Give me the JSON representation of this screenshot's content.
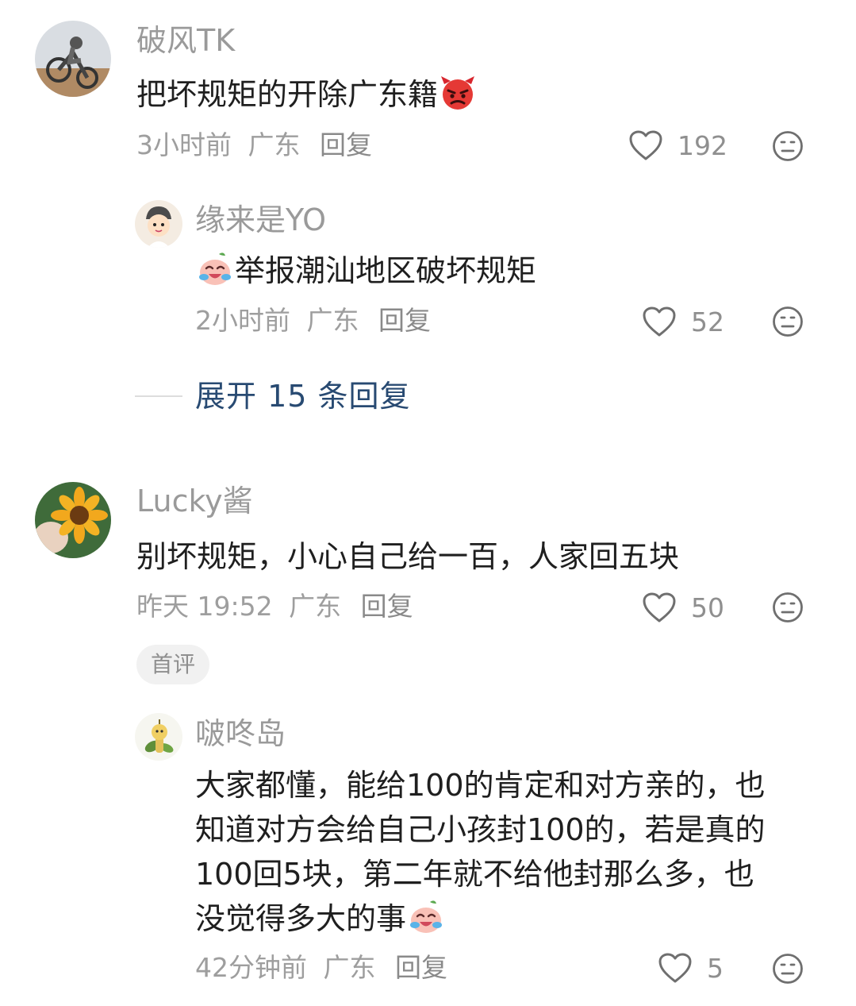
{
  "comments": [
    {
      "username": "破风TK",
      "text": "把坏规矩的开除广东籍",
      "emoji": "angry-devil-emoji",
      "time": "3小时前",
      "location": "广东",
      "reply_label": "回复",
      "likes": "192"
    },
    {
      "username": "Lucky酱",
      "text": "别坏规矩，小心自己给一百，人家回五块",
      "time": "昨天 19:52",
      "location": "广东",
      "reply_label": "回复",
      "likes": "50",
      "badge": "首评"
    }
  ],
  "replies": [
    {
      "username": "缘来是YO",
      "emoji": "crying-laughing-emoji",
      "text": "举报潮汕地区破坏规矩",
      "time": "2小时前",
      "location": "广东",
      "reply_label": "回复",
      "likes": "52"
    },
    {
      "username": "啵咚岛",
      "text_lines": [
        "大家都懂，能给100的肯定和对方亲的，也",
        "知道对方会给自己小孩封100的，若是真的",
        "100回5块，第二年就不给他封那么多，也",
        "没觉得多大的事"
      ],
      "emoji": "crying-laughing-emoji",
      "time": "42分钟前",
      "location": "广东",
      "reply_label": "回复",
      "likes": "5"
    }
  ],
  "expand_replies": "展开 15 条回复",
  "icons": {
    "like": "heart-outline-icon",
    "dislike": "meh-face-icon"
  },
  "colors": {
    "username": "#9a9a9a",
    "text": "#1f1f1f",
    "meta": "#9e9e9e",
    "expand_link": "#284a72",
    "badge_bg": "#f1f1f1"
  }
}
